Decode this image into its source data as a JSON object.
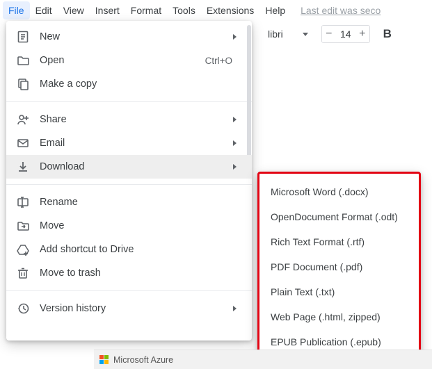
{
  "menubar": {
    "items": [
      "File",
      "Edit",
      "View",
      "Insert",
      "Format",
      "Tools",
      "Extensions",
      "Help"
    ],
    "active_index": 0,
    "edit_status": "Last edit was seco"
  },
  "toolbar": {
    "font_name": "libri",
    "font_size": "14",
    "bold_label": "B"
  },
  "file_menu": {
    "items": [
      {
        "icon": "doc-plus-icon",
        "label": "New",
        "submenu": true
      },
      {
        "icon": "folder-icon",
        "label": "Open",
        "shortcut": "Ctrl+O"
      },
      {
        "icon": "copy-icon",
        "label": "Make a copy"
      },
      {
        "sep": true
      },
      {
        "icon": "person-plus-icon",
        "label": "Share",
        "submenu": true
      },
      {
        "icon": "mail-icon",
        "label": "Email",
        "submenu": true
      },
      {
        "icon": "download-icon",
        "label": "Download",
        "submenu": true,
        "hover": true
      },
      {
        "sep": true
      },
      {
        "icon": "rename-icon",
        "label": "Rename"
      },
      {
        "icon": "move-icon",
        "label": "Move"
      },
      {
        "icon": "drive-plus-icon",
        "label": "Add shortcut to Drive"
      },
      {
        "icon": "trash-icon",
        "label": "Move to trash"
      },
      {
        "sep": true
      },
      {
        "icon": "history-icon",
        "label": "Version history",
        "submenu": true
      }
    ]
  },
  "download_submenu": {
    "items": [
      "Microsoft Word (.docx)",
      "OpenDocument Format (.odt)",
      "Rich Text Format (.rtf)",
      "PDF Document (.pdf)",
      "Plain Text (.txt)",
      "Web Page (.html, zipped)",
      "EPUB Publication (.epub)"
    ]
  },
  "taskbar": {
    "app": "Microsoft Azure"
  }
}
